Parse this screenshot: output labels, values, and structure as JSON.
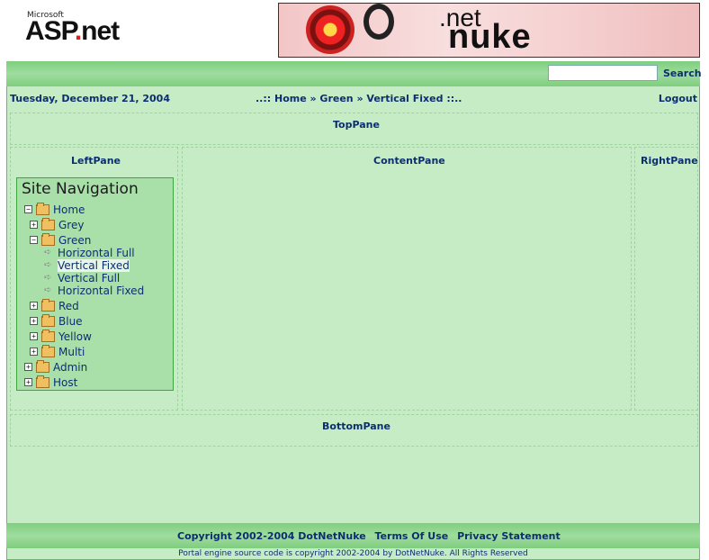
{
  "header": {
    "microsoft_label": "Microsoft",
    "asp_logo_text": "ASP",
    "asp_logo_dot": ".",
    "asp_logo_net": "net",
    "banner_net": ".net",
    "banner_nuke": "nuke"
  },
  "search": {
    "placeholder": "",
    "value": "",
    "button_label": "Search"
  },
  "topbar": {
    "date": "Tuesday, December 21, 2004",
    "breadcrumb": "..:: Home » Green » Vertical Fixed ::..",
    "logout_label": "Logout"
  },
  "panes": {
    "top": "TopPane",
    "left": "LeftPane",
    "content": "ContentPane",
    "right": "RightPane",
    "bottom": "BottomPane"
  },
  "site_navigation": {
    "title": "Site Navigation",
    "items": [
      {
        "label": "Home",
        "type": "folder",
        "expander": "−"
      },
      {
        "label": "Grey",
        "type": "folder",
        "expander": "+"
      },
      {
        "label": "Green",
        "type": "folder",
        "expander": "−"
      },
      {
        "label": "Horizontal Full",
        "type": "page"
      },
      {
        "label": "Vertical Fixed",
        "type": "page",
        "selected": true
      },
      {
        "label": "Vertical Full",
        "type": "page"
      },
      {
        "label": "Horizontal Fixed",
        "type": "page"
      },
      {
        "label": "Red",
        "type": "folder",
        "expander": "+"
      },
      {
        "label": "Blue",
        "type": "folder",
        "expander": "+"
      },
      {
        "label": "Yellow",
        "type": "folder",
        "expander": "+"
      },
      {
        "label": "Multi",
        "type": "folder",
        "expander": "+"
      },
      {
        "label": "Admin",
        "type": "folder",
        "expander": "+"
      },
      {
        "label": "Host",
        "type": "folder",
        "expander": "+"
      }
    ]
  },
  "footer": {
    "copyright": "Copyright 2002-2004 DotNetNuke",
    "terms": "Terms Of Use",
    "privacy": "Privacy Statement",
    "note": "Portal engine source code is copyright 2002-2004 by DotNetNuke. All Rights Reserved"
  },
  "colors": {
    "background": "#c6ecc6",
    "bar": "#8fd48f",
    "link": "#0d2e6e",
    "nav_box": "#a9e0a9"
  }
}
